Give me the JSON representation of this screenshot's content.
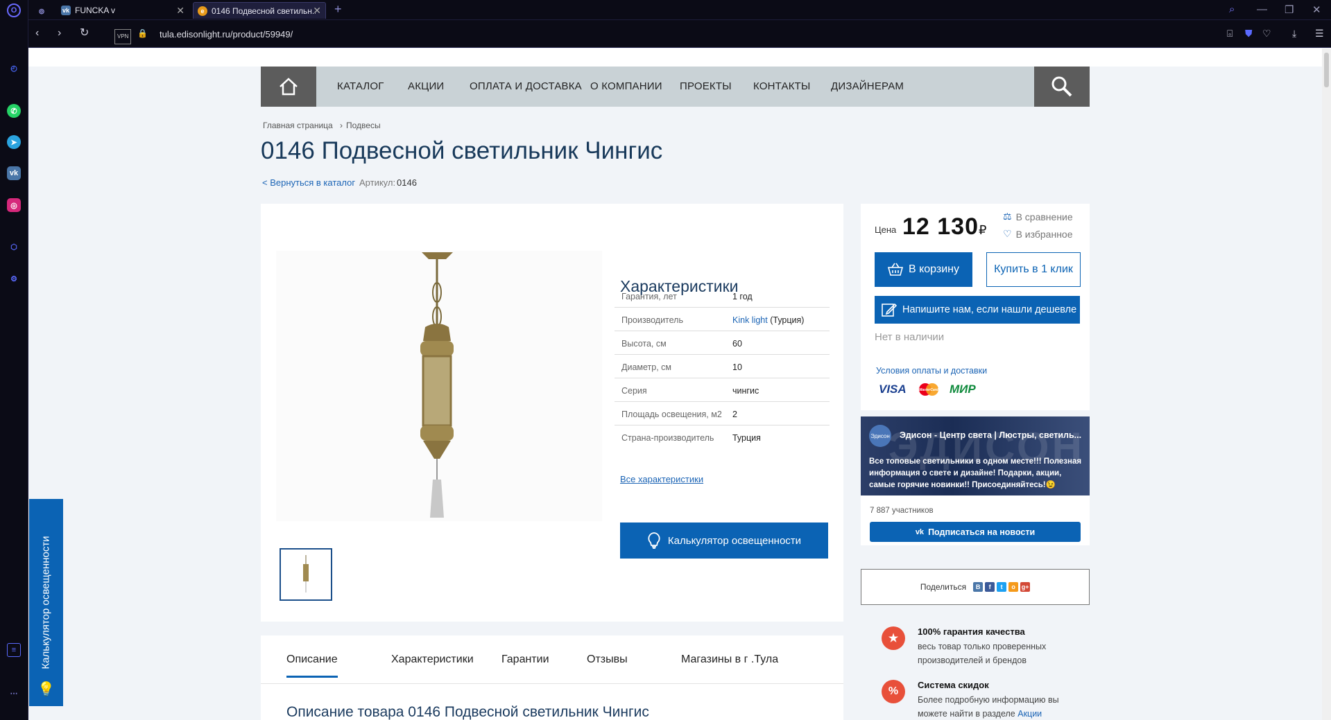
{
  "browser": {
    "tabs": [
      {
        "label": "FUNCKA v"
      },
      {
        "label": "0146 Подвесной светильн..."
      }
    ],
    "vpn_label": "VPN",
    "url": "tula.edisonlight.ru/product/59949/"
  },
  "nav": {
    "items": [
      "КАТАЛОГ",
      "АКЦИИ",
      "ОПЛАТА И ДОСТАВКА",
      "О КОМПАНИИ",
      "ПРОЕКТЫ",
      "КОНТАКТЫ",
      "ДИЗАЙНЕРАМ"
    ]
  },
  "breadcrumb": {
    "home": "Главная страница",
    "sep": "›",
    "current": "Подвесы"
  },
  "product": {
    "title": "0146 Подвесной светильник Чингис",
    "back_link": "< Вернуться в каталог",
    "article_label": "Артикул:",
    "article_value": "0146"
  },
  "characteristics": {
    "title": "Характеристики",
    "rows": [
      {
        "key": "Гарантия, лет",
        "value": "1 год"
      },
      {
        "key": "Производитель",
        "link": "Kink light",
        "value": "(Турция)"
      },
      {
        "key": "Высота, см",
        "value": "60"
      },
      {
        "key": "Диаметр, см",
        "value": "10"
      },
      {
        "key": "Серия",
        "value": "чингис"
      },
      {
        "key": "Площадь освещения, м2",
        "value": "2"
      },
      {
        "key": "Страна-производитель",
        "value": "Турция"
      }
    ],
    "all_link": "Все характеристики",
    "calc_button": "Калькулятор освещенности"
  },
  "price": {
    "label": "Цена",
    "value": "12 130",
    "currency": "₽",
    "compare": "В сравнение",
    "favorite": "В избранное",
    "cart_button": "В корзину",
    "one_click": "Купить в 1 клик",
    "cheaper_button": "Напишите нам, если нашли дешевле",
    "stock": "Нет в наличии",
    "conditions_link": "Условия оплаты и доставки",
    "payments": [
      "VISA",
      "MasterCard",
      "МИР"
    ]
  },
  "vk": {
    "avatar_text": "Эдисон",
    "bg_text": "ЭДИСОН",
    "group_name": "Эдисон - Центр света | Люстры, светиль...",
    "description": "Все топовые светильники в одном месте!!! Полезная информация о свете и дизайне! Подарки, акции, самые горячие новинки!! Присоединяйтесь!😉",
    "members": "7 887 участников",
    "subscribe_button": "Подписаться на новости"
  },
  "share": {
    "label": "Поделиться",
    "networks": [
      "В",
      "f",
      "t",
      "о",
      "g+"
    ]
  },
  "features": [
    {
      "title": "100% гарантия качества",
      "text": "весь товар только проверенных производителей и брендов"
    },
    {
      "title": "Система скидок",
      "text": "Более подробную информацию вы можете найти в разделе",
      "link": "Акции"
    }
  ],
  "product_tabs": [
    "Описание",
    "Характеристики",
    "Гарантии",
    "Отзывы",
    "Магазины в г .Тула"
  ],
  "description_title": "Описание товара 0146 Подвесной светильник Чингис",
  "side_widget": "Калькулятор освещенности",
  "colors": {
    "brand_blue": "#0b63b4",
    "nav_bg": "#c9d2d6",
    "nav_dark": "#5c5c5c",
    "accent_red": "#e8503a"
  }
}
